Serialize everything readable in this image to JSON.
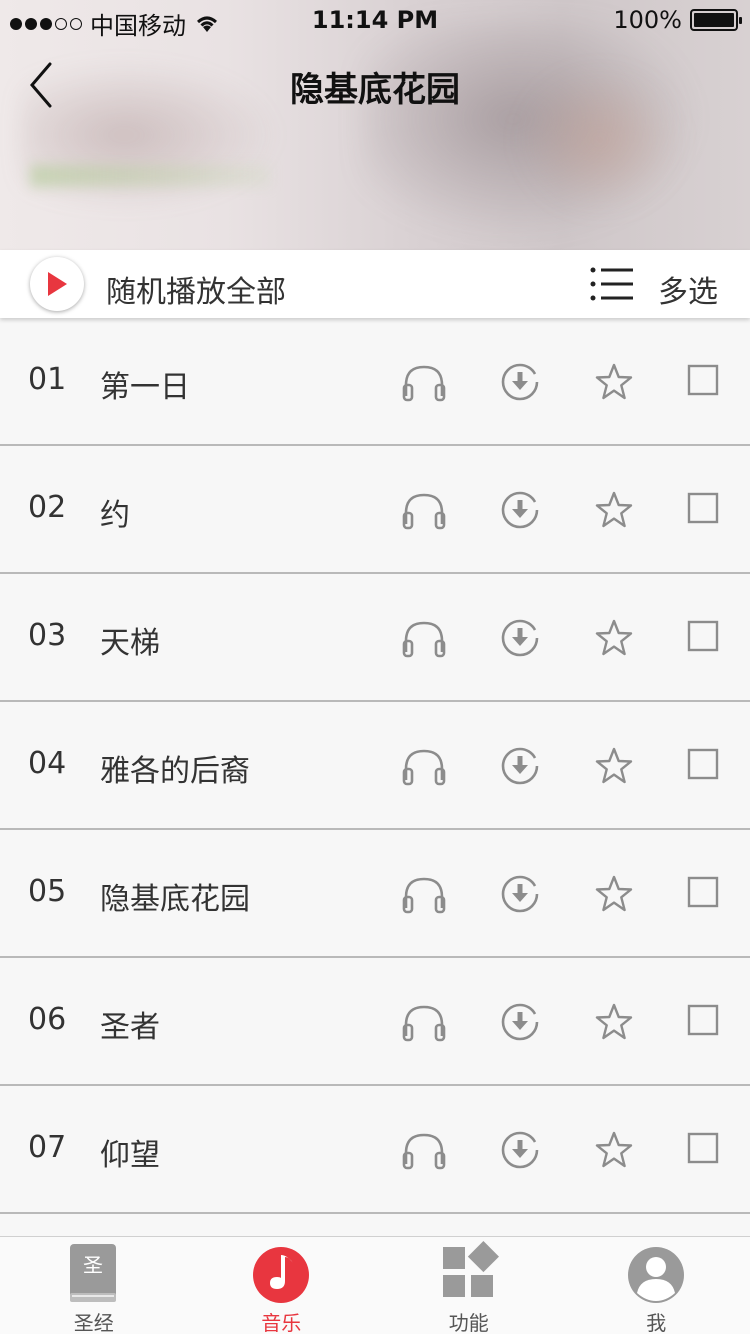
{
  "status_bar": {
    "carrier": "中国移动",
    "time": "11:14 PM",
    "battery": "100%"
  },
  "nav": {
    "title": "隐基底花园"
  },
  "play_bar": {
    "play_all_label": "随机播放全部",
    "multi_select_label": "多选"
  },
  "songs": [
    {
      "num": "01",
      "title": "第一日"
    },
    {
      "num": "02",
      "title": "约"
    },
    {
      "num": "03",
      "title": "天梯"
    },
    {
      "num": "04",
      "title": "雅各的后裔"
    },
    {
      "num": "05",
      "title": "隐基底花园"
    },
    {
      "num": "06",
      "title": "圣者"
    },
    {
      "num": "07",
      "title": "仰望"
    }
  ],
  "tabs": [
    {
      "label": "圣经",
      "icon": "bible-icon"
    },
    {
      "label": "音乐",
      "icon": "music-note-icon"
    },
    {
      "label": "功能",
      "icon": "functions-grid-icon"
    },
    {
      "label": "我",
      "icon": "user-avatar-icon"
    }
  ],
  "tab_bible_glyph": "圣",
  "colors": {
    "accent": "#e8363f",
    "icon_gray": "#8c8c8c",
    "divider": "#b9b9b9"
  }
}
